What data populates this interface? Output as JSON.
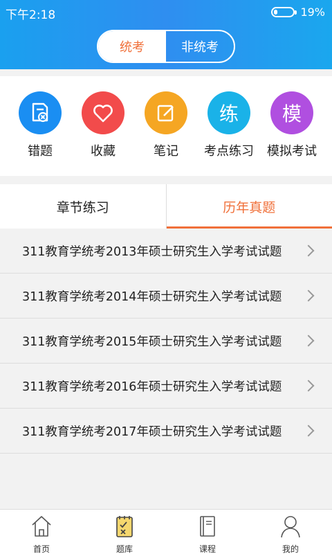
{
  "status": {
    "time": "下午2:18",
    "battery_text": "19%",
    "battery_level": 0.19
  },
  "segment": {
    "active": "统考",
    "inactive": "非统考"
  },
  "quick_actions": [
    {
      "label": "错题",
      "icon": "wrong-question-icon",
      "glyph": "",
      "color": "#1a8ef2"
    },
    {
      "label": "收藏",
      "icon": "heart-icon",
      "glyph": "",
      "color": "#f24b4b"
    },
    {
      "label": "笔记",
      "icon": "note-edit-icon",
      "glyph": "",
      "color": "#f5a623"
    },
    {
      "label": "考点练习",
      "icon": "practice-icon",
      "glyph": "练",
      "color": "#1ab2e8"
    },
    {
      "label": "模拟考试",
      "icon": "mock-exam-icon",
      "glyph": "模",
      "color": "#b04fe0"
    }
  ],
  "tabs": {
    "chapter": "章节练习",
    "past": "历年真题"
  },
  "exam_list": [
    "311教育学统考2013年硕士研究生入学考试试题",
    "311教育学统考2014年硕士研究生入学考试试题",
    "311教育学统考2015年硕士研究生入学考试试题",
    "311教育学统考2016年硕士研究生入学考试试题",
    "311教育学统考2017年硕士研究生入学考试试题"
  ],
  "bottom_nav": [
    {
      "label": "首页",
      "icon": "home-icon"
    },
    {
      "label": "题库",
      "icon": "question-bank-icon"
    },
    {
      "label": "课程",
      "icon": "course-book-icon"
    },
    {
      "label": "我的",
      "icon": "profile-icon"
    }
  ]
}
